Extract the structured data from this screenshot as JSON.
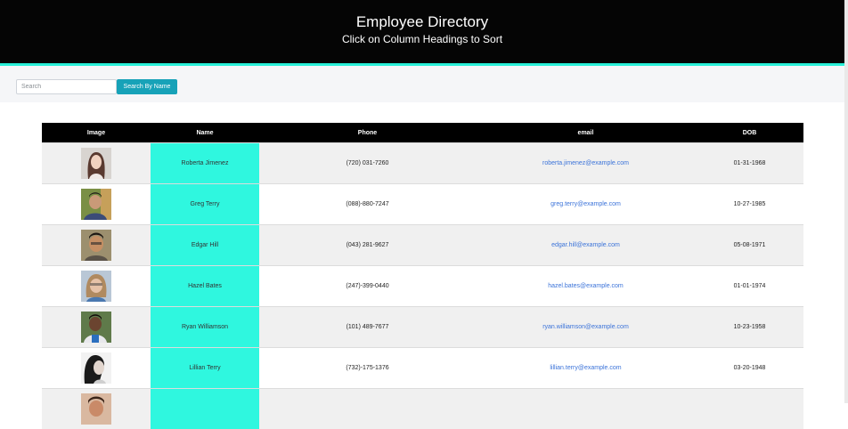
{
  "header": {
    "title": "Employee Directory",
    "subtitle": "Click on Column Headings to Sort"
  },
  "search": {
    "placeholder": "Search",
    "button_label": "Search By Name"
  },
  "table": {
    "columns": [
      "Image",
      "Name",
      "Phone",
      "email",
      "DOB"
    ],
    "rows": [
      {
        "name": "Roberta Jimenez",
        "phone": "(720) 031-7260",
        "email": "roberta.jimenez@example.com",
        "dob": "01-31-1968"
      },
      {
        "name": "Greg Terry",
        "phone": "(088)-880-7247",
        "email": "greg.terry@example.com",
        "dob": "10-27-1985"
      },
      {
        "name": "Edgar Hill",
        "phone": "(043) 281-9627",
        "email": "edgar.hill@example.com",
        "dob": "05-08-1971"
      },
      {
        "name": "Hazel Bates",
        "phone": "(247)-399-0440",
        "email": "hazel.bates@example.com",
        "dob": "01-01-1974"
      },
      {
        "name": "Ryan Williamson",
        "phone": "(101) 489-7677",
        "email": "ryan.williamson@example.com",
        "dob": "10-23-1958"
      },
      {
        "name": "Lillian Terry",
        "phone": "(732)-175-1376",
        "email": "lillian.terry@example.com",
        "dob": "03-20-1948"
      },
      {
        "name": "",
        "phone": "",
        "email": "",
        "dob": ""
      }
    ]
  },
  "colors": {
    "header_bg": "#050505",
    "accent": "#28f0d8",
    "name_column_bg": "#2ff7df",
    "button_bg": "#17a2b8",
    "link": "#3b73d9"
  },
  "icons": [
    "employee-photo"
  ]
}
